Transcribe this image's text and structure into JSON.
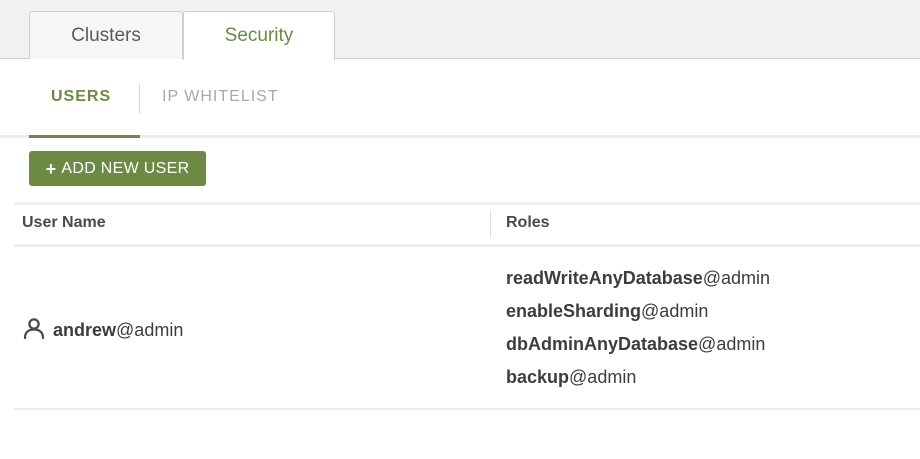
{
  "top_tabs": [
    {
      "label": "Clusters",
      "active": false
    },
    {
      "label": "Security",
      "active": true
    }
  ],
  "sub_tabs": [
    {
      "label": "USERS",
      "active": true
    },
    {
      "label": "IP WHITELIST",
      "active": false
    }
  ],
  "add_button": {
    "icon": "plus-icon",
    "label": "ADD NEW USER"
  },
  "table": {
    "headers": {
      "name": "User Name",
      "roles": "Roles"
    },
    "rows": [
      {
        "user": {
          "icon": "user-icon",
          "name": "andrew",
          "realm": "@admin"
        },
        "roles": [
          {
            "name": "readWriteAnyDatabase",
            "db": "@admin"
          },
          {
            "name": "enableSharding",
            "db": "@admin"
          },
          {
            "name": "dbAdminAnyDatabase",
            "db": "@admin"
          },
          {
            "name": "backup",
            "db": "@admin"
          }
        ]
      }
    ]
  },
  "colors": {
    "accent": "#6c8a44",
    "tab_bar_bg": "#f1f1f1",
    "muted_text": "#a8a8a8"
  }
}
